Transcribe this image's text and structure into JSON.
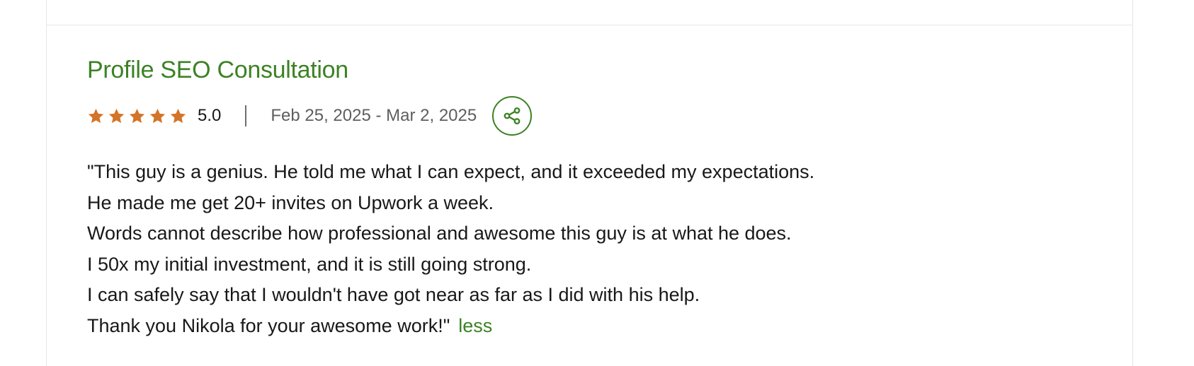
{
  "review_card": {
    "job_title": "Profile SEO Consultation",
    "rating_value": "5.0",
    "star_count": 5,
    "date_range": "Feb 25, 2025 - Mar 2, 2025",
    "share_icon": "share-icon",
    "review_lines": [
      "\"This guy is a genius. He told me what I can expect, and it exceeded my expectations.",
      "He made me get 20+ invites on Upwork a week.",
      "Words cannot describe how professional and awesome this guy is at what he does.",
      "I 50x my initial investment, and it is still going strong.",
      "I can safely say that I wouldn't have got near as far as I did with his help.",
      "Thank you Nikola for your awesome work!\""
    ],
    "less_label": "less"
  },
  "colors": {
    "accent_green": "#3c8224",
    "star_orange": "#d47428",
    "text_primary": "#181818",
    "text_secondary": "#5e5e5e",
    "border": "#e6e6e6"
  }
}
